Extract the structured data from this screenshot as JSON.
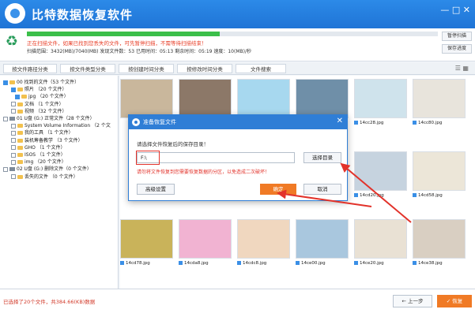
{
  "app": {
    "title": "比特数据恢复软件",
    "window_controls": "— □ ✕"
  },
  "status": {
    "progress": 0.47,
    "message": "正在扫描文件，如果已找到您丢失的文件，可先暂停扫描，不需等待扫描结束！",
    "stats": "扫描范围：3432(MB)/7040(MB)    发现文件数：53    已用时间：05:13    剩余时间：05:19    速度：10(MB)/秒"
  },
  "side_buttons": {
    "pause": "暂停扫描",
    "save_progress": "保存进度"
  },
  "tabs": [
    "按文件路径分类",
    "按文件类型分类",
    "按创建时间分类",
    "按修改时间分类",
    "文件搜索"
  ],
  "tree": [
    {
      "text": "00 找到的文件（53 个文件）",
      "indent": 0,
      "checked": true,
      "kind": "folder"
    },
    {
      "text": "照片  （20 个文件）",
      "indent": 2,
      "checked": true,
      "kind": "folder"
    },
    {
      "text": "jpg  （20 个文件）",
      "indent": 3,
      "checked": true,
      "kind": "folder"
    },
    {
      "text": "文档  （1 个文件）",
      "indent": 2,
      "checked": false,
      "kind": "folder"
    },
    {
      "text": "视频  （32 个文件）",
      "indent": 2,
      "checked": false,
      "kind": "folder"
    },
    {
      "text": "01 U盘 (G:) 正常文件（28 个文件）",
      "indent": 0,
      "checked": false,
      "kind": "drive"
    },
    {
      "text": "System Volume Information  （2 个文",
      "indent": 2,
      "checked": false,
      "kind": "folder"
    },
    {
      "text": "我的工具  （1 个文件）",
      "indent": 2,
      "checked": false,
      "kind": "folder"
    },
    {
      "text": "装机筹备教学  （3 个文件）",
      "indent": 2,
      "checked": false,
      "kind": "folder"
    },
    {
      "text": "GHO  （1 个文件）",
      "indent": 2,
      "checked": false,
      "kind": "folder"
    },
    {
      "text": "ISOS  （1 个文件）",
      "indent": 2,
      "checked": false,
      "kind": "folder"
    },
    {
      "text": "img  （20 个文件）",
      "indent": 2,
      "checked": false,
      "kind": "folder"
    },
    {
      "text": "02 U盘 (G:) 删除文件（0 个文件）",
      "indent": 0,
      "checked": false,
      "kind": "drive"
    },
    {
      "text": "丢失的文件  （0 个文件）",
      "indent": 2,
      "checked": false,
      "kind": "folder"
    }
  ],
  "thumbnails": [
    {
      "label": "",
      "color": "#c9b79c"
    },
    {
      "label": "",
      "color": "#8c7868"
    },
    {
      "label": "",
      "color": "#a7d8ef"
    },
    {
      "label": "",
      "color": "#6f8fa8"
    },
    {
      "label": "",
      "color": "#d8c6b4"
    },
    {
      "label": "",
      "color": "#f4f1ec"
    },
    {
      "label": "",
      "color": "#b9c6d0"
    },
    {
      "label": "14cc28.jpg",
      "color": "#cfe3ec"
    },
    {
      "label": "14cc80.jpg",
      "color": "#e8e4dc"
    },
    {
      "label": "14cd20.jpg",
      "color": "#c6d3df"
    },
    {
      "label": "14cd58.jpg",
      "color": "#ece6d8"
    },
    {
      "label": "14cd78.jpg",
      "color": "#c9b35a"
    },
    {
      "label": "14cda8.jpg",
      "color": "#f1b3d2"
    },
    {
      "label": "14cdc8.jpg",
      "color": "#f0d7bf"
    },
    {
      "label": "14ce00.jpg",
      "color": "#a9c7de"
    },
    {
      "label": "14ce20.jpg",
      "color": "#e9e1d4"
    },
    {
      "label": "14ce38.jpg",
      "color": "#d9cfc2"
    }
  ],
  "dialog": {
    "title": "准备恢复文件",
    "prompt": "请选择文件恢复后的保存目录！",
    "path": "F:\\",
    "select_dir": "选择目录",
    "warning": "请勿将文件恢复到您需要恢复数据的分区，以免造成二次破坏！",
    "advanced": "高级设置",
    "ok": "确定",
    "cancel": "取消"
  },
  "footer": {
    "selection_info": "已选择了20个文件，共384.66(KB)数据",
    "prev": "← 上一步",
    "recover": "✓ 恢复"
  },
  "colors": {
    "brand": "#1f74d6",
    "accent": "#f07a25",
    "warning": "#e2322a",
    "progress": "#3bbf4a"
  }
}
